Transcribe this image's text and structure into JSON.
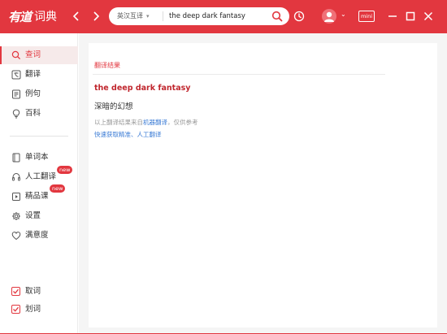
{
  "app": {
    "logo_mark": "有道",
    "logo_text": "词典"
  },
  "nav": {
    "back_glyph": "‹",
    "forward_glyph": "›"
  },
  "search": {
    "lang_label": "英汉互译",
    "query": "the deep dark fantasy",
    "placeholder": ""
  },
  "titlebar": {
    "mini_label": "mini",
    "avatar_chevron": "⌄"
  },
  "sidebar": {
    "top_items": [
      {
        "label": "查词",
        "icon": "search-icon",
        "active": true
      },
      {
        "label": "翻译",
        "icon": "translate-icon"
      },
      {
        "label": "例句",
        "icon": "example-icon"
      },
      {
        "label": "百科",
        "icon": "bulb-icon"
      }
    ],
    "mid_items": [
      {
        "label": "单词本",
        "icon": "wordbook-icon"
      },
      {
        "label": "人工翻译",
        "icon": "headset-icon",
        "badge": "new"
      },
      {
        "label": "精品课",
        "icon": "course-icon",
        "badge": "new"
      },
      {
        "label": "设置",
        "icon": "gear-icon"
      },
      {
        "label": "满意度",
        "icon": "heart-icon"
      }
    ],
    "bottom_items": [
      {
        "label": "取词",
        "checked": true
      },
      {
        "label": "划词",
        "checked": true
      }
    ]
  },
  "main": {
    "tab_label": "翻译结果",
    "query_term": "the deep dark fantasy",
    "translation": "深暗的幻想",
    "source_prefix": "以上翻译结果来自",
    "source_link": "机器翻译",
    "source_suffix": "，仅供参考",
    "human_link": "快速获取精准、人工翻译"
  },
  "colors": {
    "accent": "#e2373f",
    "link": "#3a7bd5"
  }
}
